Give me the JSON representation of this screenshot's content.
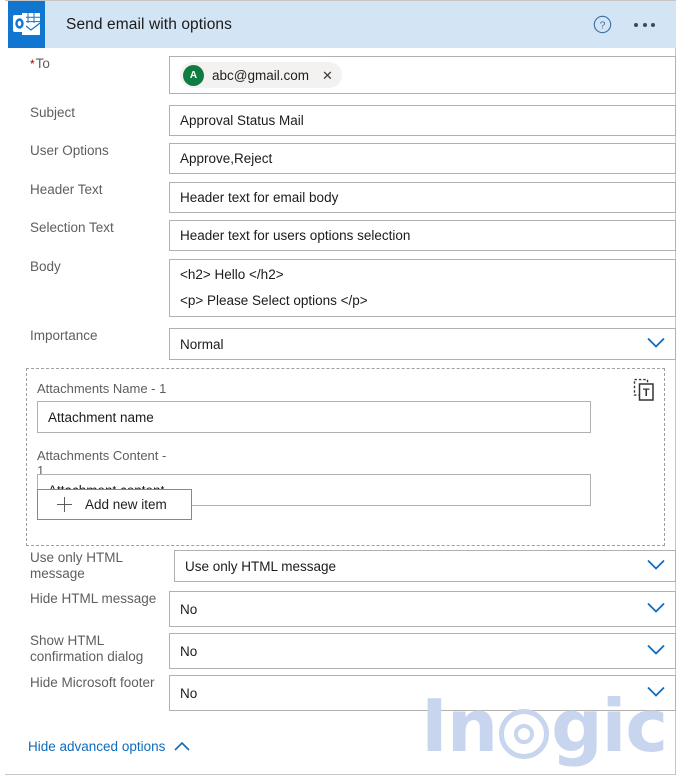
{
  "header": {
    "title": "Send email with options",
    "app_icon": "outlook-icon",
    "help_icon": "help-circle-icon",
    "more_icon": "ellipsis-icon",
    "bar_color": "#d3e4f5",
    "tile_color": "#1176d0"
  },
  "accent_color": "#0f6cbd",
  "fields": {
    "to": {
      "label": "To",
      "required": true,
      "recipient": "abc@gmail.com",
      "avatar_initial": "A",
      "avatar_color": "#107c41",
      "remove_icon": "close-icon"
    },
    "subject": {
      "label": "Subject",
      "value": "Approval Status Mail"
    },
    "user_options": {
      "label": "User Options",
      "value": "Approve,Reject"
    },
    "header_text": {
      "label": "Header Text",
      "value": "Header text for email body"
    },
    "selection_text": {
      "label": "Selection Text",
      "value": "Header text for users options selection"
    },
    "body": {
      "label": "Body",
      "line1": "<h2> Hello </h2>",
      "line2": "<p> Please Select options </p>"
    },
    "importance": {
      "label": "Importance",
      "value": "Normal",
      "chevron": "chevron-down-icon"
    },
    "use_only_html_message": {
      "label": "Use only HTML message",
      "value": "Use only HTML message",
      "chevron": "chevron-down-icon"
    },
    "hide_html_message": {
      "label": "Hide HTML message",
      "value": "No",
      "chevron": "chevron-down-icon"
    },
    "show_html_confirmation_dialog": {
      "label": "Show HTML confirmation dialog",
      "value": "No",
      "chevron": "chevron-down-icon"
    },
    "hide_microsoft_footer": {
      "label": "Hide Microsoft footer",
      "value": "No",
      "chevron": "chevron-down-icon"
    }
  },
  "attachments": {
    "name_label": "Attachments Name - 1",
    "name_value": "Attachment name",
    "content_label": "Attachments Content - 1",
    "content_value": "Attachment content",
    "delete_icon": "delete-item-icon",
    "add_button": "Add new item",
    "add_icon": "plus-icon"
  },
  "footer": {
    "hide_advanced": "Hide advanced options",
    "chevron": "chevron-up-icon"
  },
  "watermark": {
    "text_before": "In",
    "text_after": "gic"
  }
}
